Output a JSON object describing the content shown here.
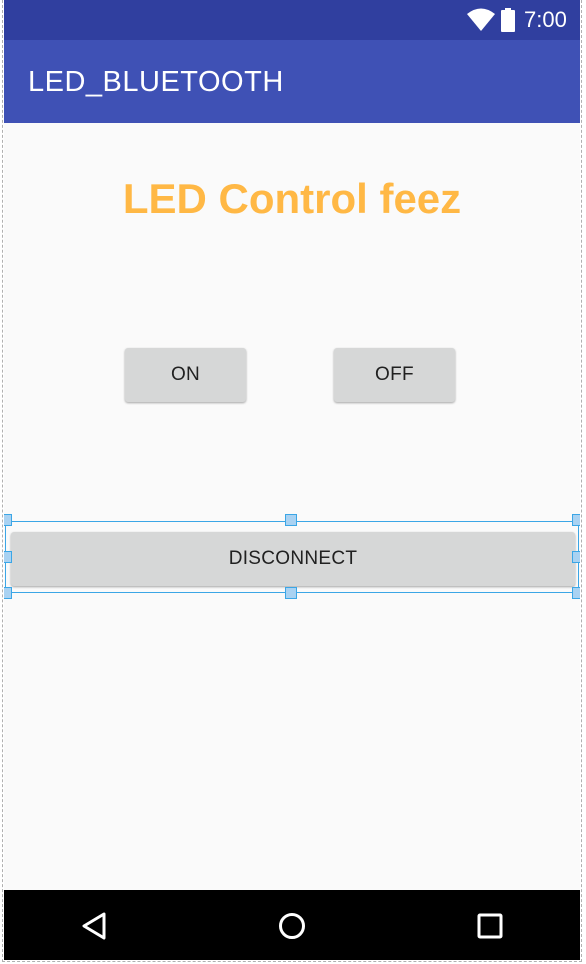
{
  "status_bar": {
    "time": "7:00",
    "wifi_icon": "wifi-icon",
    "battery_icon": "battery-icon",
    "color": "#303f9f"
  },
  "app_bar": {
    "title": "LED_BLUETOOTH",
    "color": "#3f51b5"
  },
  "main": {
    "headline": "LED Control feez",
    "headline_color": "#ffb845",
    "on_label": "ON",
    "off_label": "OFF",
    "disconnect_label": "DISCONNECT"
  },
  "nav_bar": {
    "back_icon": "back-triangle-icon",
    "home_icon": "home-circle-icon",
    "recents_icon": "recents-square-icon"
  }
}
